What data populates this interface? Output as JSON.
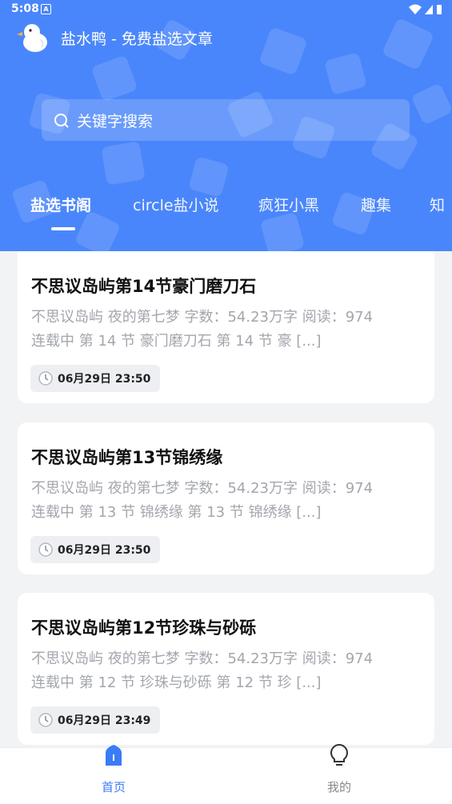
{
  "status_bar": {
    "time": "5:08",
    "notification_glyph": "A"
  },
  "app": {
    "title": "盐水鸭 - 免费盐选文章"
  },
  "search": {
    "placeholder": "关键字搜索"
  },
  "tabs": [
    {
      "label": "盐选书阁",
      "active": true
    },
    {
      "label": "circle盐小说",
      "active": false
    },
    {
      "label": "疯狂小黑",
      "active": false
    },
    {
      "label": "趣集",
      "active": false
    },
    {
      "label": "知",
      "active": false
    }
  ],
  "articles": [
    {
      "title": "不思议岛屿第14节豪门磨刀石",
      "excerpt_line1": "不思议岛屿 夜的第七梦 字数：54.23万字 阅读：974",
      "excerpt_line2": "连载中 第 14 节 豪门磨刀石 第 14 节 豪 [...]",
      "date": "06月29日 23:50"
    },
    {
      "title": "不思议岛屿第13节锦绣缘",
      "excerpt_line1": "不思议岛屿 夜的第七梦 字数：54.23万字 阅读：974",
      "excerpt_line2": "连载中 第 13 节 锦绣缘 第 13 节 锦绣缘 [...]",
      "date": "06月29日 23:50"
    },
    {
      "title": "不思议岛屿第12节珍珠与砂砾",
      "excerpt_line1": "不思议岛屿 夜的第七梦 字数：54.23万字 阅读：974",
      "excerpt_line2": "连载中 第 12 节 珍珠与砂砾 第 12 节 珍 [...]",
      "date": "06月29日 23:49"
    }
  ],
  "bottom_nav": [
    {
      "label": "首页",
      "icon": "home-icon",
      "active": true
    },
    {
      "label": "我的",
      "icon": "bulb-icon",
      "active": false
    }
  ],
  "colors": {
    "header_blue": "#4a86fb",
    "nav_active": "#3b7bf6",
    "nav_inactive": "#888888",
    "title_text": "#111111",
    "excerpt_text": "#a3a6ad"
  }
}
